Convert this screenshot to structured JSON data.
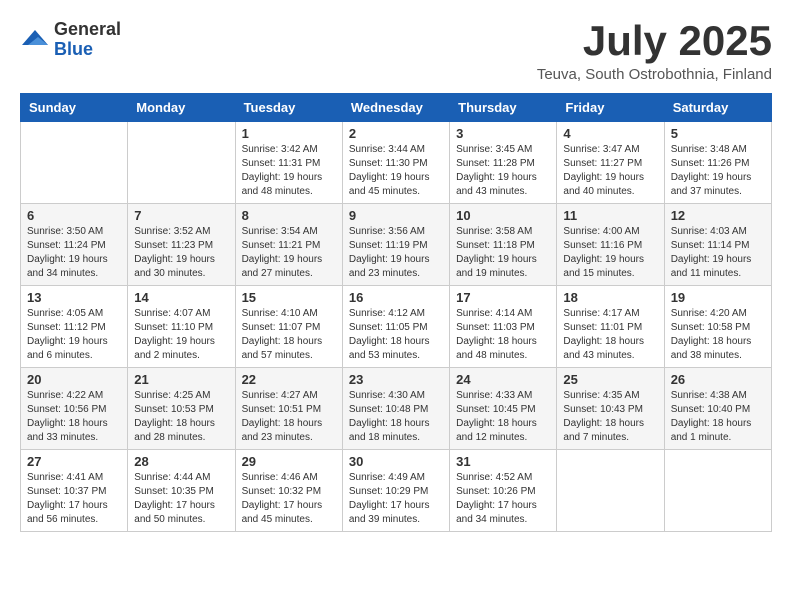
{
  "header": {
    "logo_general": "General",
    "logo_blue": "Blue",
    "month_title": "July 2025",
    "location": "Teuva, South Ostrobothnia, Finland"
  },
  "weekdays": [
    "Sunday",
    "Monday",
    "Tuesday",
    "Wednesday",
    "Thursday",
    "Friday",
    "Saturday"
  ],
  "weeks": [
    [
      {
        "day": "",
        "info": ""
      },
      {
        "day": "",
        "info": ""
      },
      {
        "day": "1",
        "info": "Sunrise: 3:42 AM\nSunset: 11:31 PM\nDaylight: 19 hours\nand 48 minutes."
      },
      {
        "day": "2",
        "info": "Sunrise: 3:44 AM\nSunset: 11:30 PM\nDaylight: 19 hours\nand 45 minutes."
      },
      {
        "day": "3",
        "info": "Sunrise: 3:45 AM\nSunset: 11:28 PM\nDaylight: 19 hours\nand 43 minutes."
      },
      {
        "day": "4",
        "info": "Sunrise: 3:47 AM\nSunset: 11:27 PM\nDaylight: 19 hours\nand 40 minutes."
      },
      {
        "day": "5",
        "info": "Sunrise: 3:48 AM\nSunset: 11:26 PM\nDaylight: 19 hours\nand 37 minutes."
      }
    ],
    [
      {
        "day": "6",
        "info": "Sunrise: 3:50 AM\nSunset: 11:24 PM\nDaylight: 19 hours\nand 34 minutes."
      },
      {
        "day": "7",
        "info": "Sunrise: 3:52 AM\nSunset: 11:23 PM\nDaylight: 19 hours\nand 30 minutes."
      },
      {
        "day": "8",
        "info": "Sunrise: 3:54 AM\nSunset: 11:21 PM\nDaylight: 19 hours\nand 27 minutes."
      },
      {
        "day": "9",
        "info": "Sunrise: 3:56 AM\nSunset: 11:19 PM\nDaylight: 19 hours\nand 23 minutes."
      },
      {
        "day": "10",
        "info": "Sunrise: 3:58 AM\nSunset: 11:18 PM\nDaylight: 19 hours\nand 19 minutes."
      },
      {
        "day": "11",
        "info": "Sunrise: 4:00 AM\nSunset: 11:16 PM\nDaylight: 19 hours\nand 15 minutes."
      },
      {
        "day": "12",
        "info": "Sunrise: 4:03 AM\nSunset: 11:14 PM\nDaylight: 19 hours\nand 11 minutes."
      }
    ],
    [
      {
        "day": "13",
        "info": "Sunrise: 4:05 AM\nSunset: 11:12 PM\nDaylight: 19 hours\nand 6 minutes."
      },
      {
        "day": "14",
        "info": "Sunrise: 4:07 AM\nSunset: 11:10 PM\nDaylight: 19 hours\nand 2 minutes."
      },
      {
        "day": "15",
        "info": "Sunrise: 4:10 AM\nSunset: 11:07 PM\nDaylight: 18 hours\nand 57 minutes."
      },
      {
        "day": "16",
        "info": "Sunrise: 4:12 AM\nSunset: 11:05 PM\nDaylight: 18 hours\nand 53 minutes."
      },
      {
        "day": "17",
        "info": "Sunrise: 4:14 AM\nSunset: 11:03 PM\nDaylight: 18 hours\nand 48 minutes."
      },
      {
        "day": "18",
        "info": "Sunrise: 4:17 AM\nSunset: 11:01 PM\nDaylight: 18 hours\nand 43 minutes."
      },
      {
        "day": "19",
        "info": "Sunrise: 4:20 AM\nSunset: 10:58 PM\nDaylight: 18 hours\nand 38 minutes."
      }
    ],
    [
      {
        "day": "20",
        "info": "Sunrise: 4:22 AM\nSunset: 10:56 PM\nDaylight: 18 hours\nand 33 minutes."
      },
      {
        "day": "21",
        "info": "Sunrise: 4:25 AM\nSunset: 10:53 PM\nDaylight: 18 hours\nand 28 minutes."
      },
      {
        "day": "22",
        "info": "Sunrise: 4:27 AM\nSunset: 10:51 PM\nDaylight: 18 hours\nand 23 minutes."
      },
      {
        "day": "23",
        "info": "Sunrise: 4:30 AM\nSunset: 10:48 PM\nDaylight: 18 hours\nand 18 minutes."
      },
      {
        "day": "24",
        "info": "Sunrise: 4:33 AM\nSunset: 10:45 PM\nDaylight: 18 hours\nand 12 minutes."
      },
      {
        "day": "25",
        "info": "Sunrise: 4:35 AM\nSunset: 10:43 PM\nDaylight: 18 hours\nand 7 minutes."
      },
      {
        "day": "26",
        "info": "Sunrise: 4:38 AM\nSunset: 10:40 PM\nDaylight: 18 hours\nand 1 minute."
      }
    ],
    [
      {
        "day": "27",
        "info": "Sunrise: 4:41 AM\nSunset: 10:37 PM\nDaylight: 17 hours\nand 56 minutes."
      },
      {
        "day": "28",
        "info": "Sunrise: 4:44 AM\nSunset: 10:35 PM\nDaylight: 17 hours\nand 50 minutes."
      },
      {
        "day": "29",
        "info": "Sunrise: 4:46 AM\nSunset: 10:32 PM\nDaylight: 17 hours\nand 45 minutes."
      },
      {
        "day": "30",
        "info": "Sunrise: 4:49 AM\nSunset: 10:29 PM\nDaylight: 17 hours\nand 39 minutes."
      },
      {
        "day": "31",
        "info": "Sunrise: 4:52 AM\nSunset: 10:26 PM\nDaylight: 17 hours\nand 34 minutes."
      },
      {
        "day": "",
        "info": ""
      },
      {
        "day": "",
        "info": ""
      }
    ]
  ]
}
